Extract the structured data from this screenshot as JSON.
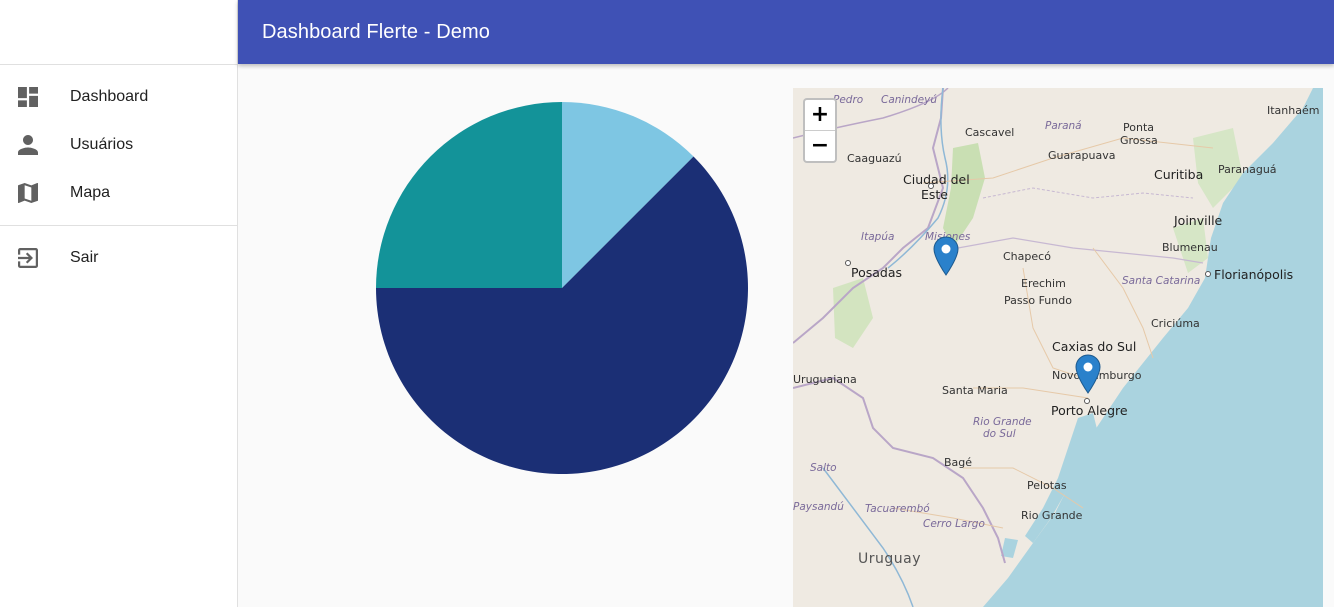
{
  "header": {
    "title": "Dashboard Flerte - Demo"
  },
  "sidebar": {
    "items": [
      {
        "label": "Dashboard",
        "icon": "dashboard-icon"
      },
      {
        "label": "Usuários",
        "icon": "person-icon"
      },
      {
        "label": "Mapa",
        "icon": "map-icon"
      }
    ],
    "logout": {
      "label": "Sair",
      "icon": "exit-icon"
    }
  },
  "colors": {
    "appbar": "#3f51b5",
    "pie": [
      "#7ec6e3",
      "#1b2f75",
      "#139399"
    ]
  },
  "chart_data": {
    "type": "pie",
    "values": [
      12.5,
      62.5,
      25
    ],
    "colors": [
      "#7ec6e3",
      "#1b2f75",
      "#139399"
    ],
    "start_angle_deg": -90,
    "direction": "clockwise"
  },
  "map": {
    "zoom_in": "+",
    "zoom_out": "−",
    "places": {
      "san_pedro": "Pedro",
      "canindeyu": "Canindeyú",
      "cascavel": "Cascavel",
      "parana": "Paraná",
      "ponta_grossa_1": "Ponta",
      "ponta_grossa_2": "Grossa",
      "itanhaem": "Itanhaém",
      "caaguazu": "Caaguazú",
      "guarapuava": "Guarapuava",
      "ciudad_del_este_1": "Ciudad del",
      "ciudad_del_este_2": "Este",
      "curitiba": "Curitiba",
      "paranagua": "Paranaguá",
      "joinville": "Joinville",
      "itapua": "Itapúa",
      "misiones": "Misiones",
      "blumenau": "Blumenau",
      "chapeco": "Chapecó",
      "posadas": "Posadas",
      "florianopolis": "Florianópolis",
      "erechim": "Erechim",
      "santa_catarina": "Santa Catarina",
      "passo_fundo": "Passo Fundo",
      "criciuma": "Criciúma",
      "caxias": "Caxias do Sul",
      "uruguaiana": "Uruguaiana",
      "novo_hamburgo": "Novo Hamburgo",
      "santa_maria": "Santa Maria",
      "porto_alegre": "Porto Alegre",
      "rio_grande_do_sul_1": "Rio Grande",
      "rio_grande_do_sul_2": "do Sul",
      "bage": "Bagé",
      "salto": "Salto",
      "pelotas": "Pelotas",
      "paysandu": "Paysandú",
      "tacuarembo": "Tacuarembó",
      "rio_grande": "Rio Grande",
      "cerro_largo": "Cerro Largo",
      "uruguay": "Uruguay"
    }
  }
}
